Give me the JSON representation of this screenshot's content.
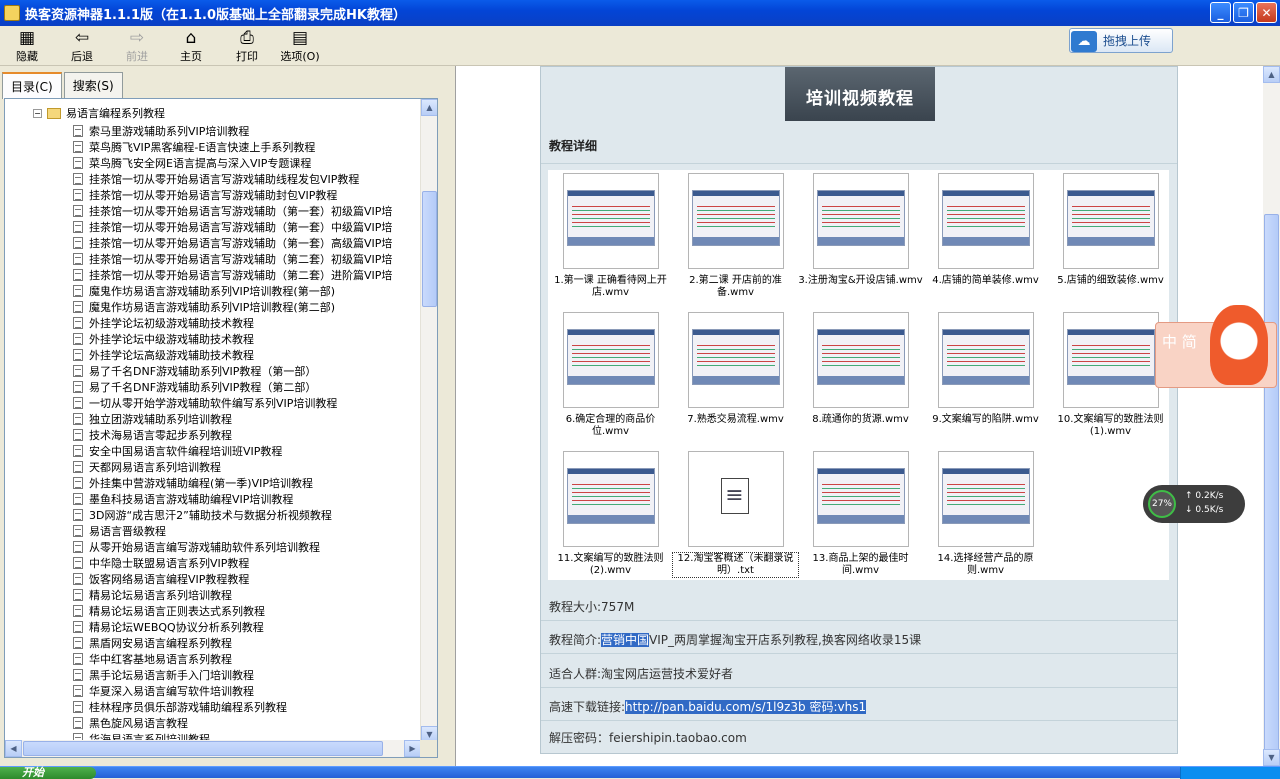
{
  "window": {
    "title": "换客资源神器1.1.1版（在1.1.0版基础上全部翻录完成HK教程）",
    "min": "_",
    "max": "❐",
    "close": "✕"
  },
  "toolbar": {
    "hide": "隐藏",
    "back": "后退",
    "forward": "前进",
    "home": "主页",
    "print": "打印",
    "options": "选项(O)",
    "upload": "拖拽上传"
  },
  "tabs": {
    "toc": "目录(C)",
    "search": "搜索(S)"
  },
  "tree": {
    "root": "易语言编程系列教程",
    "items": [
      "索马里游戏辅助系列VIP培训教程",
      "菜鸟腾飞VIP黑客编程-E语言快速上手系列教程",
      "菜鸟腾飞安全网E语言提高与深入VIP专题课程",
      "挂茶馆一切从零开始易语言写游戏辅助线程发包VIP教程",
      "挂茶馆一切从零开始易语言写游戏辅助封包VIP教程",
      "挂茶馆一切从零开始易语言写游戏辅助（第一套）初级篇VIP培",
      "挂茶馆一切从零开始易语言写游戏辅助（第一套）中级篇VIP培",
      "挂茶馆一切从零开始易语言写游戏辅助（第一套）高级篇VIP培",
      "挂茶馆一切从零开始易语言写游戏辅助（第二套）初级篇VIP培",
      "挂茶馆一切从零开始易语言写游戏辅助（第二套）进阶篇VIP培",
      "魔鬼作坊易语言游戏辅助系列VIP培训教程(第一部)",
      "魔鬼作坊易语言游戏辅助系列VIP培训教程(第二部)",
      "外挂学论坛初级游戏辅助技术教程",
      "外挂学论坛中级游戏辅助技术教程",
      "外挂学论坛高级游戏辅助技术教程",
      "易了千名DNF游戏辅助系列VIP教程（第一部）",
      "易了千名DNF游戏辅助系列VIP教程（第二部）",
      "一切从零开始学游戏辅助软件编写系列VIP培训教程",
      "独立团游戏辅助系列培训教程",
      "技术海易语言零起步系列教程",
      "安全中国易语言软件编程培训班VIP教程",
      "天都网易语言系列培训教程",
      "外挂集中营游戏辅助编程(第一季)VIP培训教程",
      "墨鱼科技易语言游戏辅助编程VIP培训教程",
      "3D网游“成吉思汗2”辅助技术与数据分析视频教程",
      "易语言晋级教程",
      "从零开始易语言编写游戏辅助软件系列培训教程",
      "中华隐士联盟易语言系列VIP教程",
      "饭客网络易语言编程VIP教程教程",
      "精易论坛易语言系列培训教程",
      "精易论坛易语言正则表达式系列教程",
      "精易论坛WEBQQ协议分析系列教程",
      "黑盾网安易语言编程系列教程",
      "华中红客基地易语言系列教程",
      "黑手论坛易语言新手入门培训教程",
      "华夏深入易语言编写软件培训教程",
      "桂林程序员俱乐部游戏辅助编程系列教程",
      "黑色旋风易语言教程",
      "华海易语言系列培训教程"
    ]
  },
  "content": {
    "banner": "培训视频教程",
    "section_title": "教程详细",
    "videos": [
      "1.第一课 正确看待网上开店.wmv",
      "2.第二课 开店前的准备.wmv",
      "3.注册淘宝&开设店铺.wmv",
      "4.店铺的简单装修.wmv",
      "5.店铺的细致装修.wmv",
      "6.确定合理的商品价位.wmv",
      "7.熟悉交易流程.wmv",
      "8.疏通你的货源.wmv",
      "9.文案编写的陷阱.wmv",
      "10.文案编写的致胜法则(1).wmv",
      "11.文案编写的致胜法则(2).wmv",
      "12.淘宝客概述（未翻录说明）.txt",
      "13.商品上架的最佳时间.wmv",
      "14.选择经营产品的原则.wmv"
    ],
    "size_label": "教程大小:757M",
    "intro_label": "教程简介:",
    "intro_highlight": "营销中国",
    "intro_rest": "VIP_两周掌握淘宝开店系列教程,换客网络收录15课",
    "audience": "适合人群:淘宝网店运营技术爱好者",
    "download_label": "高速下载链接:",
    "download_link": "http://pan.baidu.com/s/1l9z3b 密码:vhs1",
    "password": "解压密码：feiershipin.taobao.com"
  },
  "ime": {
    "label": "中 简"
  },
  "netspeed": {
    "percent": "27%",
    "up": "0.2K/s",
    "down": "0.5K/s"
  },
  "taskbar": {
    "start": "开始"
  },
  "colors": {
    "titlebar": "#0a5bea",
    "highlight": "#316ac5",
    "panel": "#dfe8ed"
  }
}
